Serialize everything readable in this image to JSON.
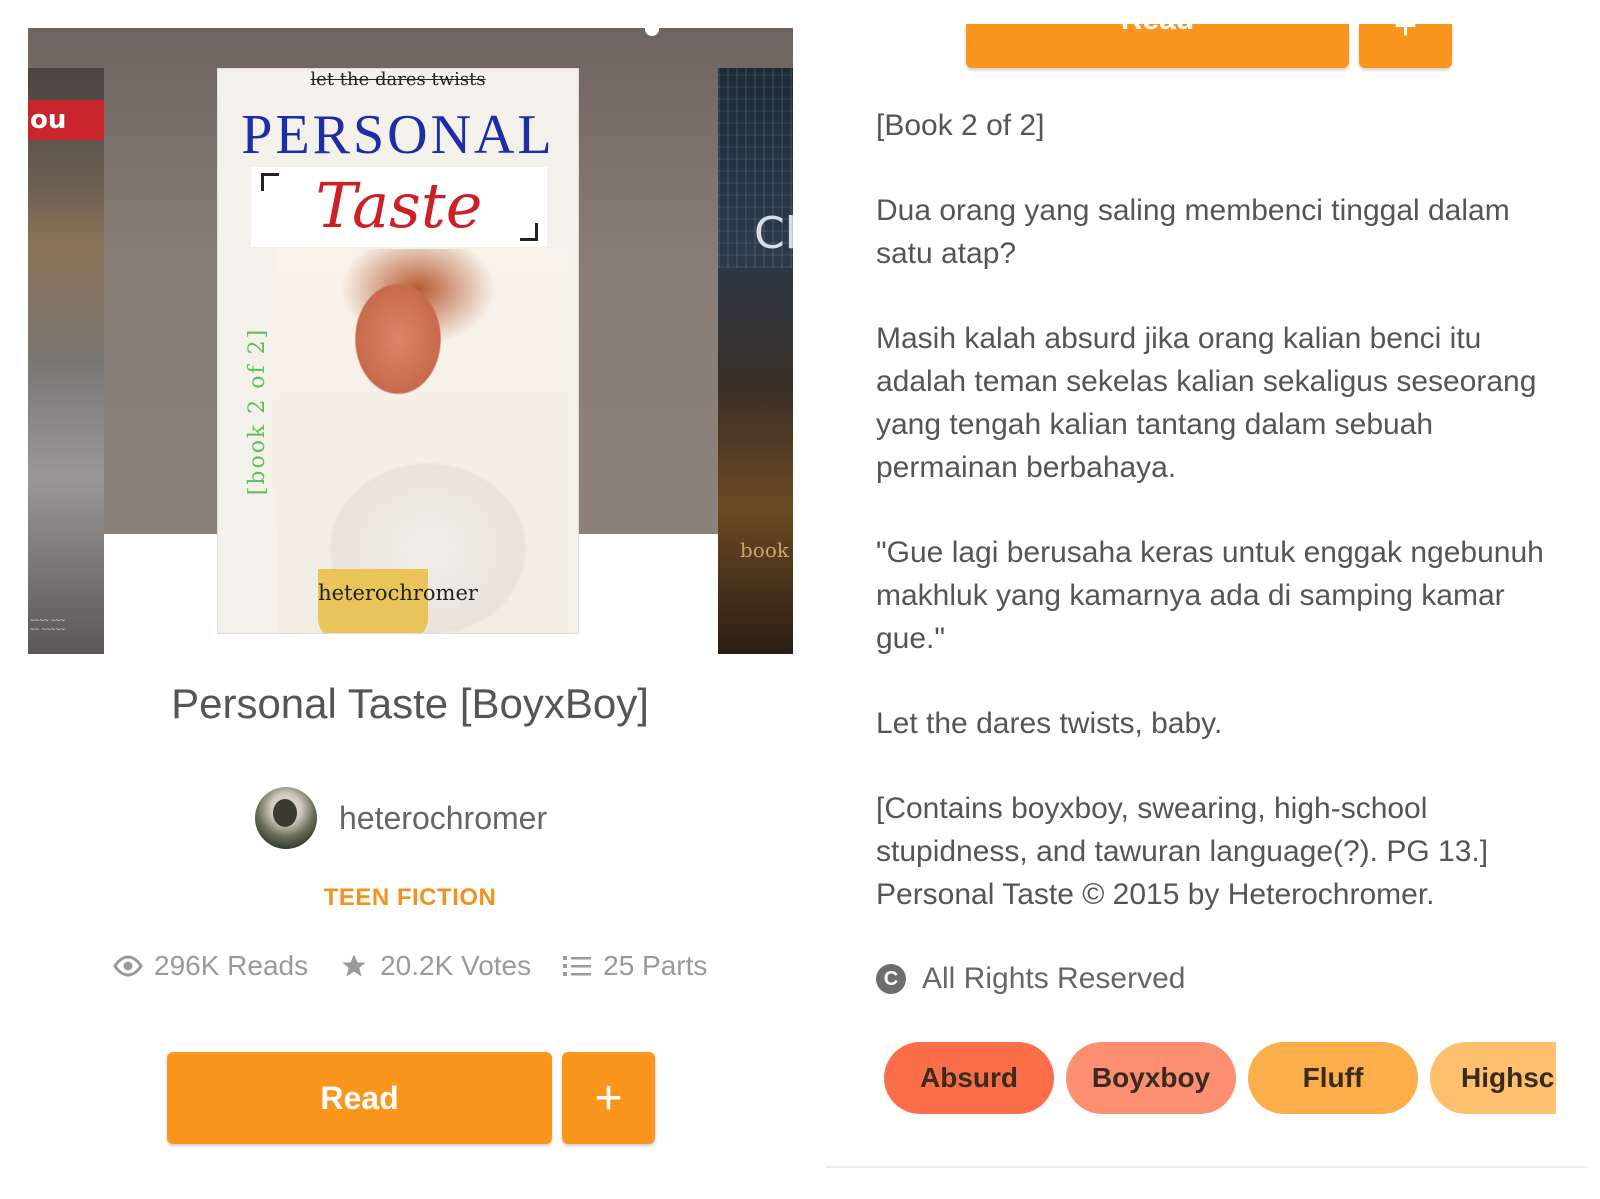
{
  "cover": {
    "tagline": "let the dares twists",
    "title_line1": "PERSONAL",
    "title_line2": "Taste",
    "vertical_text": "[book 2 of 2]",
    "author": "heterochromer",
    "left_cover_text": "ou",
    "right_cover_letter": "Cl",
    "right_cover_word": "book"
  },
  "story": {
    "title": "Personal Taste [BoyxBoy]",
    "author": "heterochromer",
    "category": "TEEN FICTION",
    "stats": {
      "reads": "296K Reads",
      "votes": "20.2K Votes",
      "parts": "25 Parts"
    },
    "read_label": "Read",
    "add_label": "+"
  },
  "right": {
    "top_read_label": "Read",
    "top_add_label": "+",
    "description": [
      "[Book 2 of 2]",
      "Dua orang yang saling membenci tinggal dalam satu atap?",
      "Masih kalah absurd jika orang kalian benci itu adalah teman sekelas kalian sekaligus seseorang yang tengah kalian tantang dalam sebuah permainan berbahaya.",
      "\"Gue lagi berusaha keras untuk enggak ngebunuh makhluk yang kamarnya ada di samping kamar gue.\"",
      "Let the dares twists, baby.",
      "[Contains boyxboy, swearing, high-school stupidness, and tawuran language(?). PG 13.] Personal Taste © 2015 by Heterochromer."
    ],
    "rights": "All Rights Reserved",
    "rights_icon": "C",
    "tags": [
      {
        "label": "Absurd",
        "color": "#fb6e4a"
      },
      {
        "label": "Boyxboy",
        "color": "#fc8e72"
      },
      {
        "label": "Fluff",
        "color": "#fbae4a"
      },
      {
        "label": "Highschool",
        "color": "#fdc06e"
      }
    ]
  },
  "colors": {
    "accent": "#fa951e",
    "category": "#f2931f"
  }
}
